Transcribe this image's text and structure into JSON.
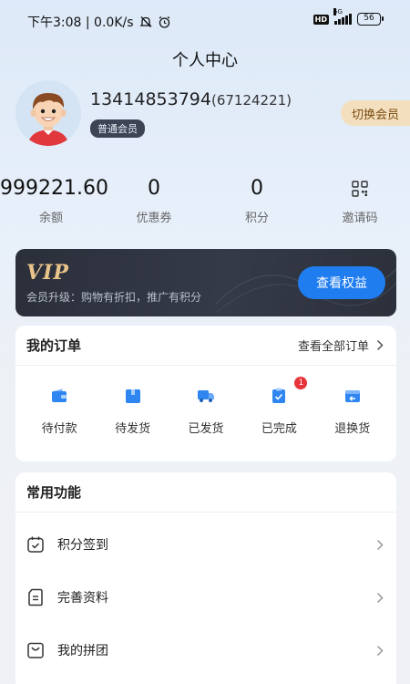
{
  "status_bar": {
    "time_speed": "下午3:08 | 0.0K/s",
    "hd": "HD",
    "net": "5G",
    "battery": "56"
  },
  "page_title": "个人中心",
  "profile": {
    "phone": "13414853794",
    "uid": "(67124221)",
    "member_level": "普通会员",
    "switch_label": "切换会员"
  },
  "stats": [
    {
      "value": "999221.60",
      "label": "余额"
    },
    {
      "value": "0",
      "label": "优惠券"
    },
    {
      "value": "0",
      "label": "积分"
    },
    {
      "label": "邀请码",
      "icon": "qrcode-icon"
    }
  ],
  "vip": {
    "logo": "VIP",
    "description": "会员升级：购物有折扣，推广有积分",
    "button": "查看权益"
  },
  "orders": {
    "title": "我的订单",
    "view_all": "查看全部订单",
    "items": [
      {
        "label": "待付款",
        "icon": "wallet-icon"
      },
      {
        "label": "待发货",
        "icon": "box-icon"
      },
      {
        "label": "已发货",
        "icon": "truck-icon"
      },
      {
        "label": "已完成",
        "icon": "clipboard-check-icon",
        "badge": "1"
      },
      {
        "label": "退换货",
        "icon": "return-icon"
      }
    ]
  },
  "functions": {
    "title": "常用功能",
    "items": [
      {
        "label": "积分签到",
        "icon": "calendar-check-icon"
      },
      {
        "label": "完善资料",
        "icon": "document-icon"
      },
      {
        "label": "我的拼团",
        "icon": "bag-icon"
      }
    ]
  },
  "colors": {
    "accent_blue": "#1f7df0",
    "vip_gold": "#e9c48a",
    "badge_red": "#e8333a",
    "switch_bg": "#f3dfbd"
  }
}
